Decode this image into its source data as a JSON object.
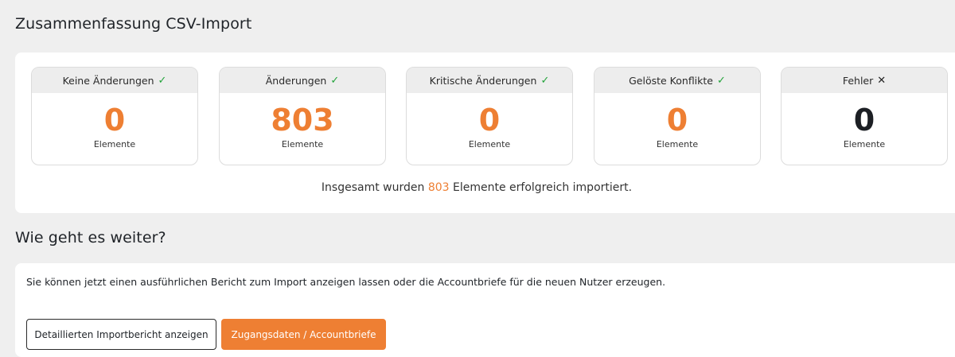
{
  "summary": {
    "title": "Zusammenfassung CSV-Import",
    "cards": [
      {
        "label": "Keine Änderungen",
        "status_icon": "check-icon",
        "status_glyph": "✓",
        "value": "0",
        "unit": "Elemente"
      },
      {
        "label": "Änderungen",
        "status_icon": "check-icon",
        "status_glyph": "✓",
        "value": "803",
        "unit": "Elemente"
      },
      {
        "label": "Kritische Änderungen",
        "status_icon": "check-icon",
        "status_glyph": "✓",
        "value": "0",
        "unit": "Elemente"
      },
      {
        "label": "Gelöste Konflikte",
        "status_icon": "check-icon",
        "status_glyph": "✓",
        "value": "0",
        "unit": "Elemente"
      },
      {
        "label": "Fehler",
        "status_icon": "x-icon",
        "status_glyph": "✕",
        "value": "0",
        "unit": "Elemente"
      }
    ],
    "result_prefix": "Insgesamt wurden ",
    "result_count": "803",
    "result_suffix": " Elemente erfolgreich importiert."
  },
  "next": {
    "title": "Wie geht es weiter?",
    "text": "Sie können jetzt einen ausführlichen Bericht zum Import anzeigen lassen oder die Accountbriefe für die neuen Nutzer erzeugen.",
    "report_button": "Detaillierten Importbericht anzeigen",
    "letters_button": "Zugangsdaten / Accountbriefe"
  },
  "colors": {
    "accent": "#ee7f33",
    "success": "#22a33a",
    "background": "#efefef"
  }
}
